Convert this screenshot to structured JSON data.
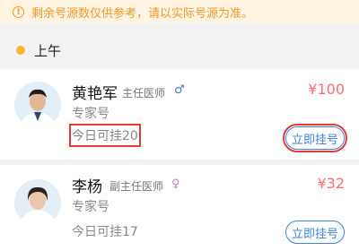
{
  "notice": {
    "icon": "warning-icon",
    "text": "剩余号源数仅供参考，请以实际号源为准。"
  },
  "section": {
    "label": "上午"
  },
  "doctors": [
    {
      "name": "黄艳军",
      "title": "主任医师",
      "gender_icon": "♂",
      "type": "专家号",
      "availability": "今日可挂20",
      "price": "¥100",
      "button": "立即挂号"
    },
    {
      "name": "李杨",
      "title": "副主任医师",
      "gender_icon": "♀",
      "type": "专家号",
      "availability": "今日可挂17",
      "price": "¥32",
      "button": "立即挂号"
    }
  ],
  "colors": {
    "notice_bg": "#fff3e2",
    "notice_text": "#f39a2b",
    "price": "#ff6f6f",
    "button": "#3f83dd",
    "dot": "#f7b731",
    "highlight_box": "#e43a3a"
  }
}
